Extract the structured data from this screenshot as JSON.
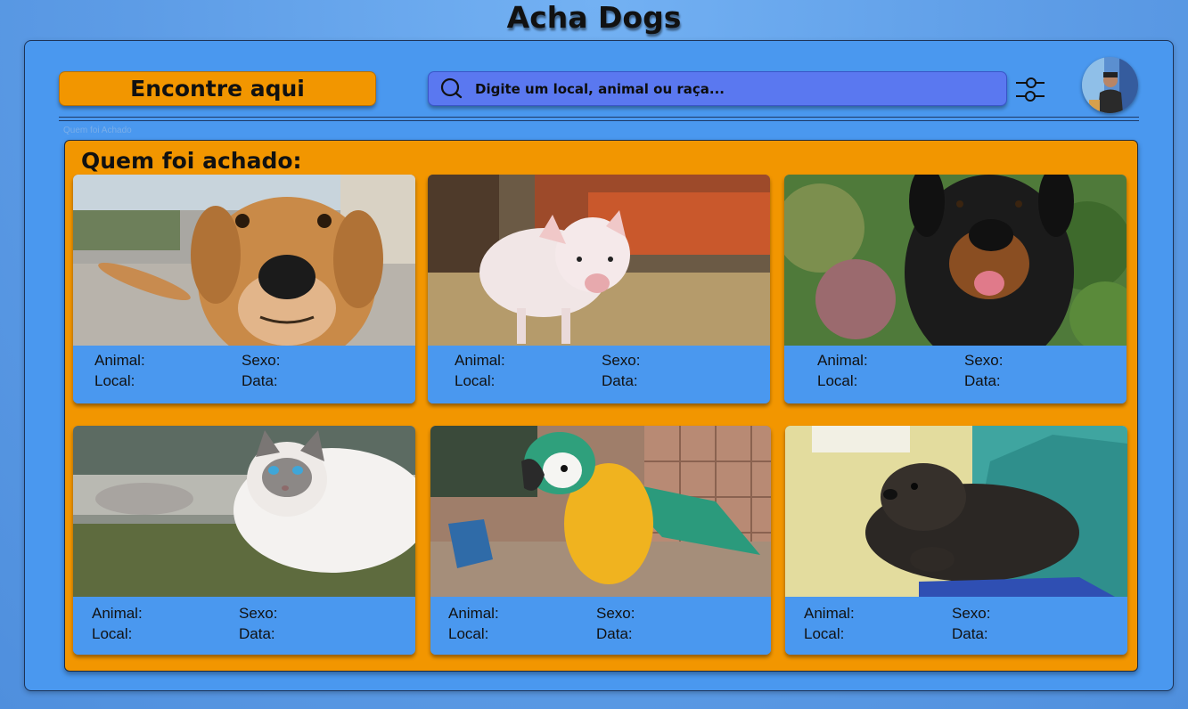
{
  "app": {
    "title": "Acha Dogs"
  },
  "header": {
    "find_button": "Encontre aqui",
    "search_placeholder": "Digite um local, animal ou raça...",
    "search_icon": "search-icon",
    "filter_icon": "sliders-icon",
    "avatar": "user-avatar"
  },
  "breadcrumb": "Quem foi Achado",
  "panel": {
    "title": "Quem foi achado:"
  },
  "labels": {
    "animal": "Animal:",
    "sexo": "Sexo:",
    "local": "Local:",
    "data": "Data:"
  },
  "cards": [
    {
      "photo": "dog-photo"
    },
    {
      "photo": "pig-photo"
    },
    {
      "photo": "rottweiler-photo"
    },
    {
      "photo": "cat-photo"
    },
    {
      "photo": "macaw-photo"
    },
    {
      "photo": "otter-photo"
    }
  ],
  "colors": {
    "background": "#5d9ce6",
    "frame": "#4a98ef",
    "accent": "#f29600",
    "search": "#5a78f0"
  }
}
